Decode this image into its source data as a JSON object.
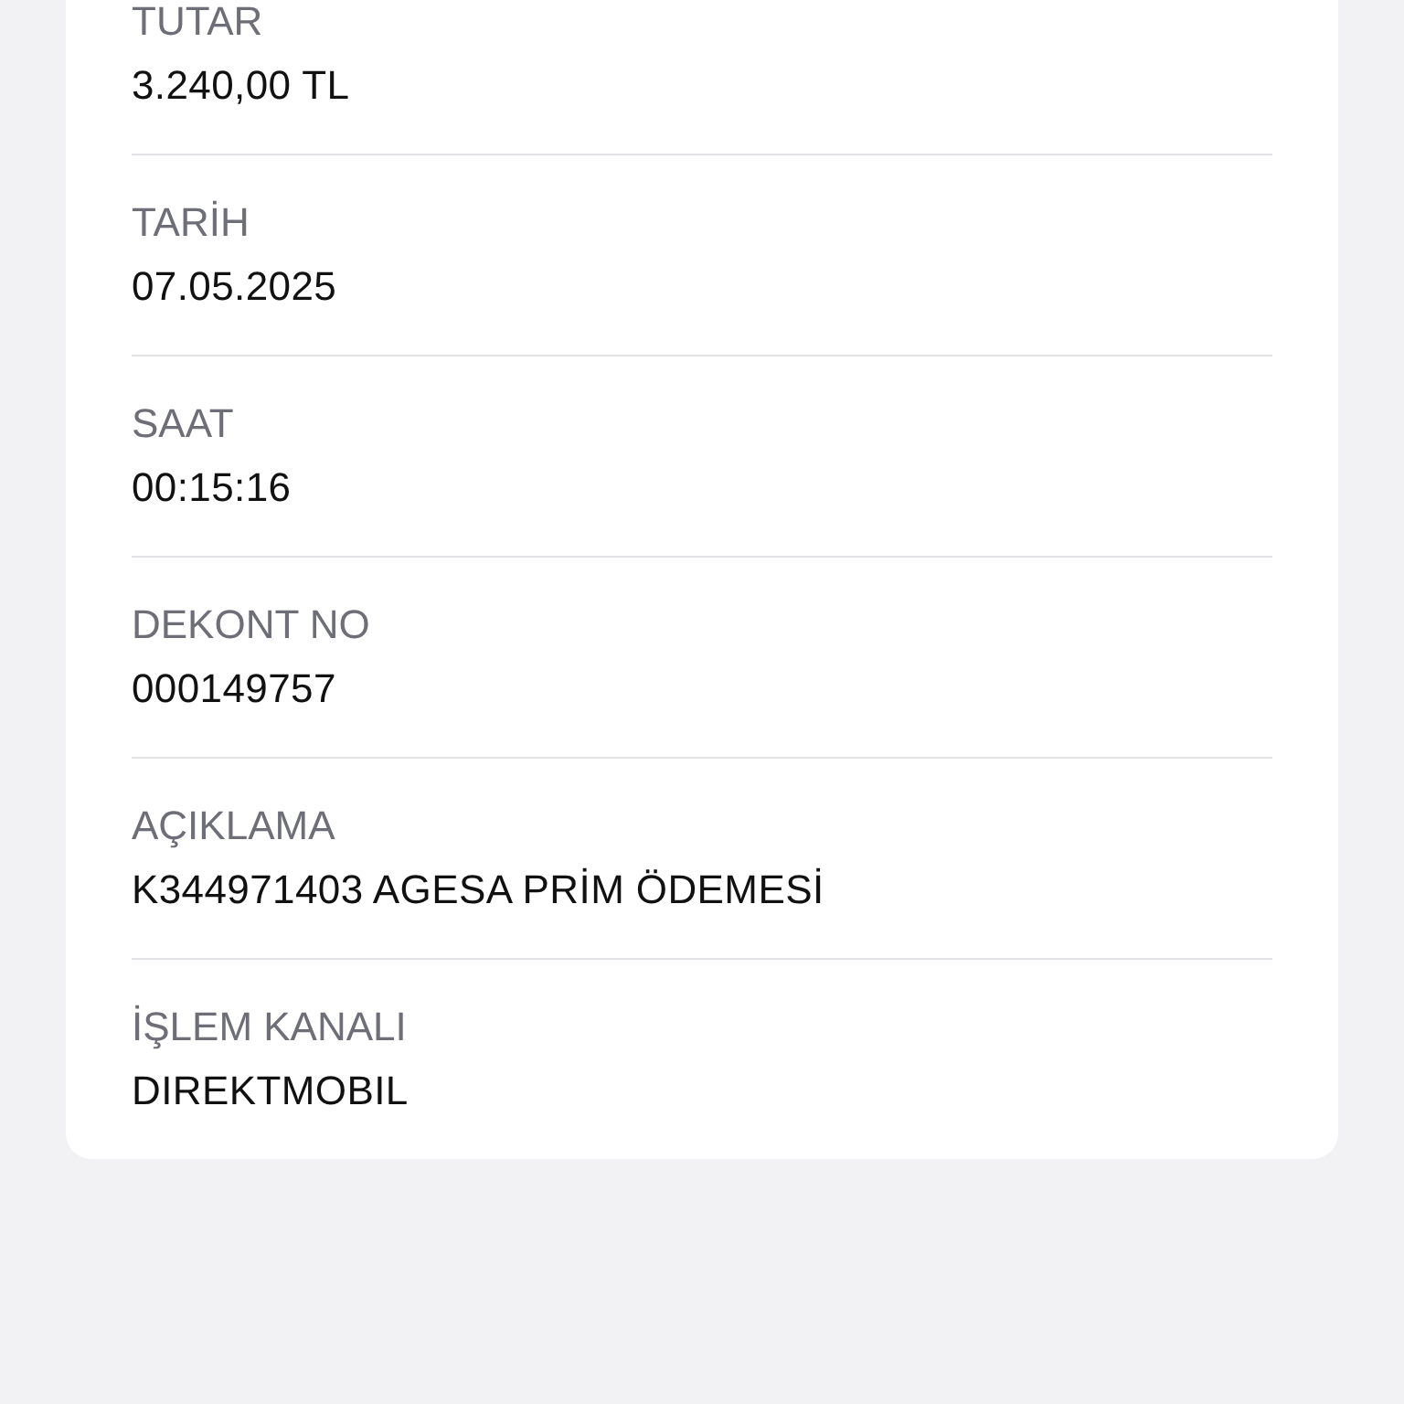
{
  "details": [
    {
      "label": "TUTAR",
      "value": "3.240,00 TL"
    },
    {
      "label": "TARİH",
      "value": "07.05.2025"
    },
    {
      "label": "SAAT",
      "value": "00:15:16"
    },
    {
      "label": "DEKONT NO",
      "value": "000149757"
    },
    {
      "label": "AÇIKLAMA",
      "value": "K344971403 AGESA PRİM ÖDEMESİ"
    },
    {
      "label": "İŞLEM KANALI",
      "value": "DIREKTMOBIL"
    }
  ]
}
